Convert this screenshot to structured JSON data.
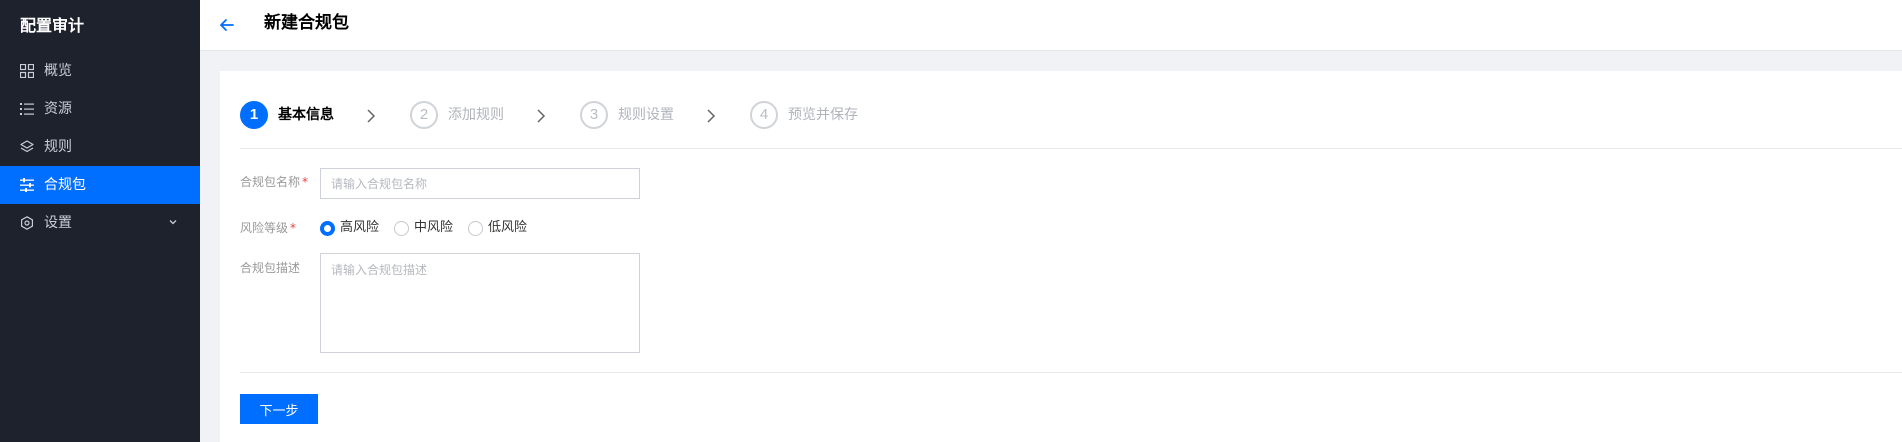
{
  "sidebar": {
    "title": "配置审计",
    "items": [
      {
        "label": "概览",
        "icon": "grid-icon"
      },
      {
        "label": "资源",
        "icon": "list-icon"
      },
      {
        "label": "规则",
        "icon": "layers-icon"
      },
      {
        "label": "合规包",
        "icon": "sliders-icon",
        "active": true
      },
      {
        "label": "设置",
        "icon": "settings-icon",
        "expandable": true
      }
    ]
  },
  "header": {
    "title": "新建合规包",
    "back_icon": "arrow-left-icon"
  },
  "steps": [
    {
      "number": "1",
      "label": "基本信息",
      "active": true
    },
    {
      "number": "2",
      "label": "添加规则"
    },
    {
      "number": "3",
      "label": "规则设置"
    },
    {
      "number": "4",
      "label": "预览并保存"
    }
  ],
  "form": {
    "name_label": "合规包名称",
    "name_placeholder": "请输入合规包名称",
    "risk_label": "风险等级",
    "risk_options": [
      "高风险",
      "中风险",
      "低风险"
    ],
    "risk_selected": "高风险",
    "desc_label": "合规包描述",
    "desc_placeholder": "请输入合规包描述",
    "required_mark": "*"
  },
  "actions": {
    "next_label": "下一步"
  },
  "colors": {
    "accent": "#006eff",
    "sidebar_bg": "#1e222d",
    "required": "#e54545"
  }
}
